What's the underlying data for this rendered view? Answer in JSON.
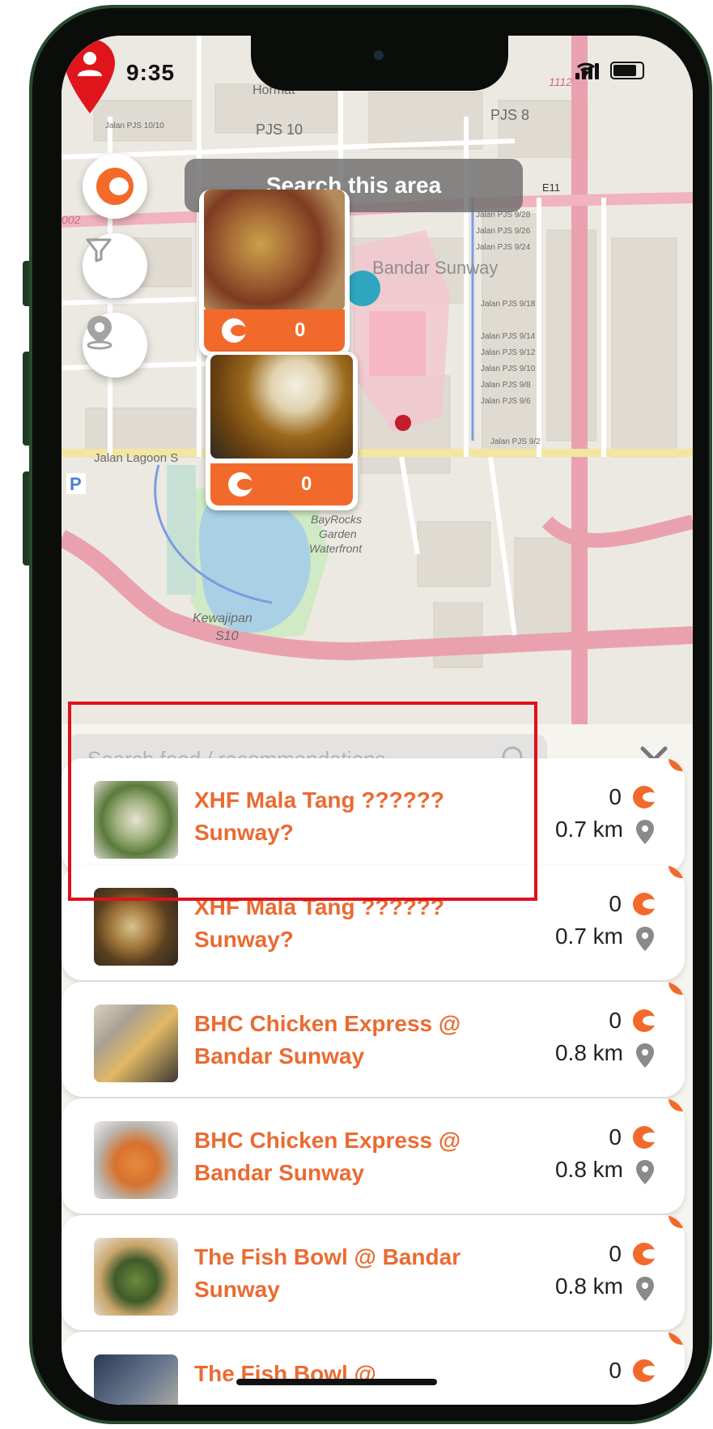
{
  "status": {
    "time": "9:35"
  },
  "map": {
    "search_area_label": "Search this area",
    "labels": [
      "Hormat",
      "PJS 10",
      "PJS 8",
      "E11",
      "Jalan Lagoon S",
      "Bandar Sunway",
      "BayRocks Garden Waterfront",
      "Kewajipan",
      "S10",
      "Jalan PJS 10/10",
      "Jalan PJS 9/28",
      "Jalan PJS 9/26",
      "Jalan PJS 9/24",
      "Jalan PJS 9/18",
      "Jalan PJS 9/14",
      "Jalan PJS 9/12",
      "Jalan PJS 9/10",
      "Jalan PJS 9/8",
      "Jalan PJS 9/6",
      "Jalan PJS 9/2",
      "1112",
      "002",
      "P"
    ],
    "cards": [
      {
        "count": "0"
      },
      {
        "count": "0"
      }
    ]
  },
  "side_buttons": {
    "logo": "logo-c-icon",
    "filter": "filter-icon",
    "location": "location-icon"
  },
  "search": {
    "placeholder": "Search food / recommendations"
  },
  "restaurants": [
    {
      "name": "XHF Mala Tang ?????? Sunway?",
      "count": "0",
      "distance": "0.7 km"
    },
    {
      "name": "XHF Mala Tang ?????? Sunway?",
      "count": "0",
      "distance": "0.7 km"
    },
    {
      "name": "BHC Chicken Express @ Bandar Sunway",
      "count": "0",
      "distance": "0.8 km"
    },
    {
      "name": "BHC Chicken Express @ Bandar Sunway",
      "count": "0",
      "distance": "0.8 km"
    },
    {
      "name": "The Fish Bowl @ Bandar Sunway",
      "count": "0",
      "distance": "0.8 km"
    },
    {
      "name": "The Fish Bowl @",
      "count": "0",
      "distance": ""
    }
  ],
  "colors": {
    "accent": "#f26a2b",
    "highlight": "#e0101a"
  }
}
